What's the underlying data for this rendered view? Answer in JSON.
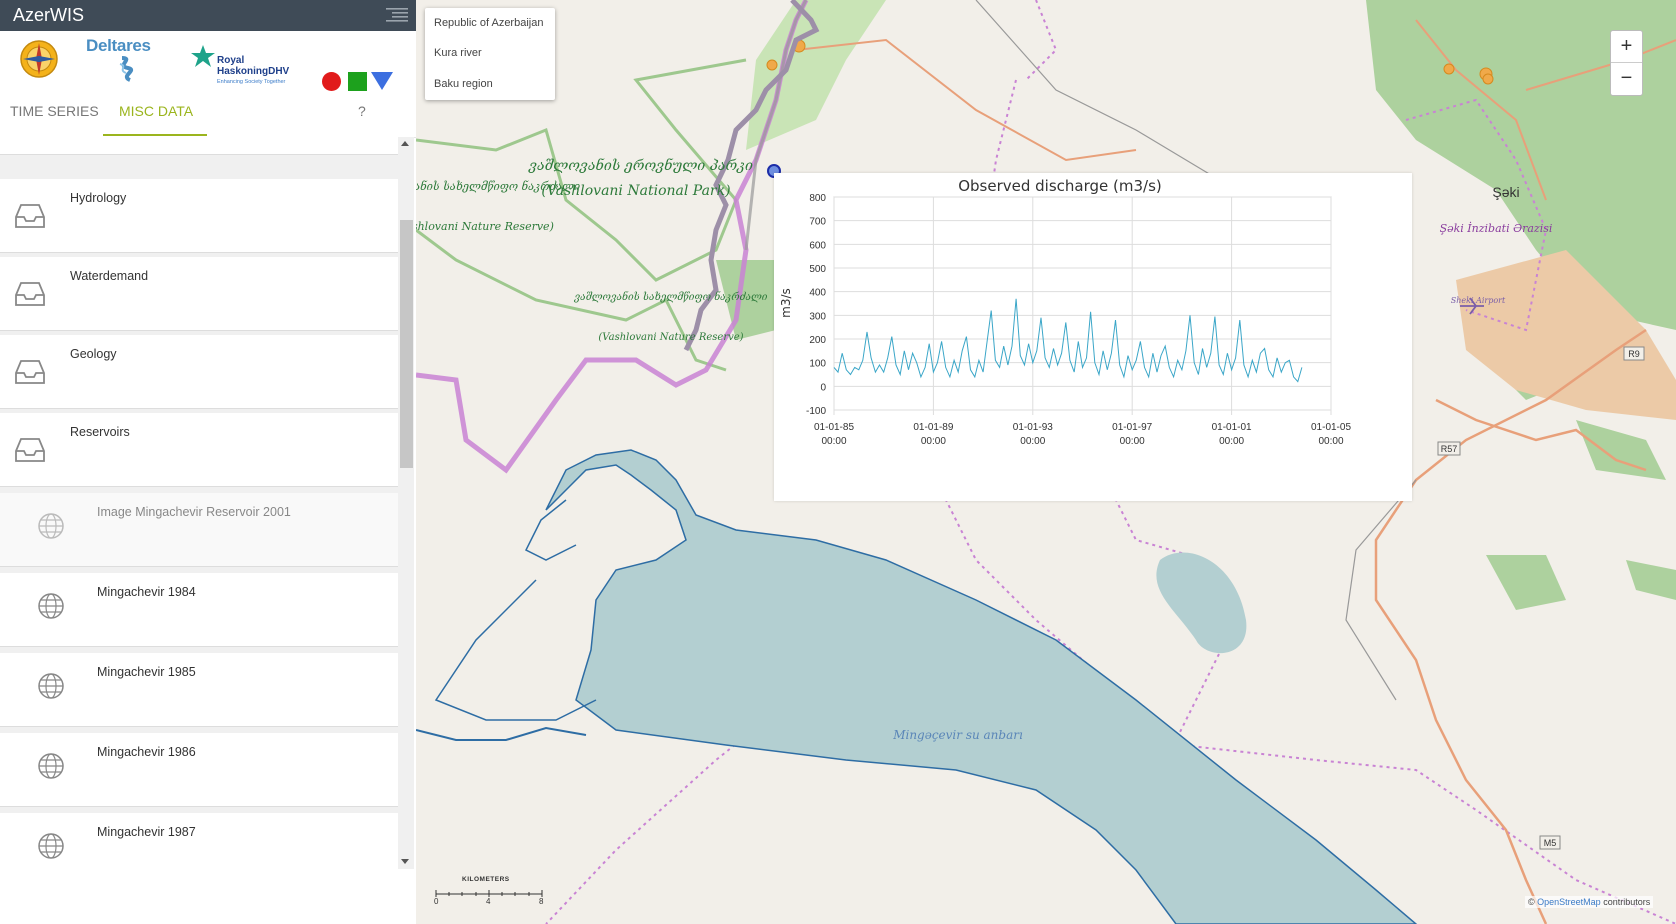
{
  "app": {
    "title": "AzerWIS"
  },
  "logos": {
    "deltares": "Deltares",
    "rhdhv_name": "Royal HaskoningDHV",
    "rhdhv_tagline": "Enhancing Society Together"
  },
  "tabs": {
    "time_series": "TIME SERIES",
    "misc_data": "MISC DATA",
    "help": "?"
  },
  "categories": [
    {
      "label": "Hydrology",
      "icon": "inbox-tray-icon"
    },
    {
      "label": "Waterdemand",
      "icon": "inbox-tray-icon"
    },
    {
      "label": "Geology",
      "icon": "inbox-tray-icon"
    },
    {
      "label": "Reservoirs",
      "icon": "inbox-tray-icon"
    }
  ],
  "layers": [
    {
      "label": "Image Mingachevir Reservoir 2001",
      "icon": "globe-icon",
      "enabled": false
    },
    {
      "label": "Mingachevir 1984",
      "icon": "globe-icon",
      "enabled": true
    },
    {
      "label": "Mingachevir 1985",
      "icon": "globe-icon",
      "enabled": true
    },
    {
      "label": "Mingachevir 1986",
      "icon": "globe-icon",
      "enabled": true
    },
    {
      "label": "Mingachevir 1987",
      "icon": "globe-icon",
      "enabled": true
    }
  ],
  "breadcrumb": [
    "Republic of Azerbaijan",
    "Kura river",
    "Baku region"
  ],
  "map": {
    "labels": {
      "vashlovani_np_ka": "ვაშლოვანის ეროვნული პარკი",
      "vashlovani_np_en": "(Vashlovani National Park)",
      "vashlovani_nr_ka": "ვაშლოვანის სახელმწიფო ნაკრძალი",
      "vashlovani_nr_en": "(Vashlovani Nature Reserve)",
      "reservoir": "Mingəçevir su anbarı",
      "city": "Şəki",
      "district": "Şəki İnzibati Ərazisi",
      "airport": "Sheki Airport",
      "road_r9": "R9",
      "road_r57": "R57",
      "road_m5": "M5"
    },
    "scalebar": {
      "title": "KILOMETERS",
      "ticks": [
        "0",
        "4",
        "8"
      ]
    },
    "attribution": {
      "prefix": "© ",
      "link": "OpenStreetMap",
      "suffix": " contributors"
    },
    "zoom": {
      "in": "+",
      "out": "−"
    },
    "colors": {
      "water": "#b3cfd1",
      "water_line": "#2e6da4",
      "forest": "#a9cf8c",
      "boundary": "#c77ad0",
      "highway": "#e8a07a",
      "farmland": "#e8c4a4"
    }
  },
  "chart_data": {
    "type": "line",
    "title": "Observed discharge (m3/s)",
    "ylabel": "m3/s",
    "xlabel": "",
    "ylim": [
      -100,
      800
    ],
    "yticks": [
      800,
      700,
      600,
      500,
      400,
      300,
      200,
      100,
      0,
      -100
    ],
    "xlim": [
      "1985-01-01",
      "2005-01-01"
    ],
    "xticks": [
      {
        "date": "1985-01-01",
        "label": "01-01-85",
        "time": "00:00"
      },
      {
        "date": "1989-01-01",
        "label": "01-01-89",
        "time": "00:00"
      },
      {
        "date": "1993-01-01",
        "label": "01-01-93",
        "time": "00:00"
      },
      {
        "date": "1997-01-01",
        "label": "01-01-97",
        "time": "00:00"
      },
      {
        "date": "2001-01-01",
        "label": "01-01-01",
        "time": "00:00"
      },
      {
        "date": "2005-01-01",
        "label": "01-01-05",
        "time": "00:00"
      }
    ],
    "grid": true,
    "series": [
      {
        "color": "#3aa6c8",
        "points": [
          [
            "1985-01-01",
            80
          ],
          [
            "1985-03-01",
            60
          ],
          [
            "1985-05-01",
            140
          ],
          [
            "1985-07-01",
            70
          ],
          [
            "1985-09-01",
            50
          ],
          [
            "1985-11-01",
            80
          ],
          [
            "1986-01-01",
            70
          ],
          [
            "1986-03-01",
            110
          ],
          [
            "1986-05-01",
            230
          ],
          [
            "1986-07-01",
            120
          ],
          [
            "1986-09-01",
            60
          ],
          [
            "1986-11-01",
            90
          ],
          [
            "1987-01-01",
            60
          ],
          [
            "1987-03-01",
            120
          ],
          [
            "1987-05-01",
            210
          ],
          [
            "1987-07-01",
            90
          ],
          [
            "1987-09-01",
            50
          ],
          [
            "1987-11-01",
            150
          ],
          [
            "1988-01-01",
            70
          ],
          [
            "1988-03-01",
            140
          ],
          [
            "1988-05-01",
            100
          ],
          [
            "1988-07-01",
            40
          ],
          [
            "1988-09-01",
            80
          ],
          [
            "1988-11-01",
            180
          ],
          [
            "1989-01-01",
            60
          ],
          [
            "1989-03-01",
            100
          ],
          [
            "1989-05-01",
            190
          ],
          [
            "1989-07-01",
            80
          ],
          [
            "1989-09-01",
            40
          ],
          [
            "1989-11-01",
            110
          ],
          [
            "1990-01-01",
            60
          ],
          [
            "1990-03-01",
            150
          ],
          [
            "1990-05-01",
            210
          ],
          [
            "1990-07-01",
            70
          ],
          [
            "1990-09-01",
            40
          ],
          [
            "1990-11-01",
            110
          ],
          [
            "1991-01-01",
            60
          ],
          [
            "1991-03-01",
            190
          ],
          [
            "1991-05-01",
            320
          ],
          [
            "1991-07-01",
            110
          ],
          [
            "1991-09-01",
            80
          ],
          [
            "1991-11-01",
            170
          ],
          [
            "1992-01-01",
            90
          ],
          [
            "1992-03-01",
            170
          ],
          [
            "1992-05-01",
            370
          ],
          [
            "1992-07-01",
            130
          ],
          [
            "1992-09-01",
            90
          ],
          [
            "1992-11-01",
            180
          ],
          [
            "1993-01-01",
            100
          ],
          [
            "1993-03-01",
            150
          ],
          [
            "1993-05-01",
            290
          ],
          [
            "1993-07-01",
            120
          ],
          [
            "1993-09-01",
            80
          ],
          [
            "1993-11-01",
            160
          ],
          [
            "1994-01-01",
            90
          ],
          [
            "1994-03-01",
            140
          ],
          [
            "1994-05-01",
            270
          ],
          [
            "1994-07-01",
            110
          ],
          [
            "1994-09-01",
            60
          ],
          [
            "1994-11-01",
            190
          ],
          [
            "1995-01-01",
            80
          ],
          [
            "1995-03-01",
            120
          ],
          [
            "1995-05-01",
            315
          ],
          [
            "1995-07-01",
            100
          ],
          [
            "1995-09-01",
            50
          ],
          [
            "1995-11-01",
            150
          ],
          [
            "1996-01-01",
            70
          ],
          [
            "1996-03-01",
            140
          ],
          [
            "1996-05-01",
            280
          ],
          [
            "1996-07-01",
            90
          ],
          [
            "1996-09-01",
            40
          ],
          [
            "1996-11-01",
            130
          ],
          [
            "1997-01-01",
            70
          ],
          [
            "1997-03-01",
            110
          ],
          [
            "1997-05-01",
            190
          ],
          [
            "1997-07-01",
            80
          ],
          [
            "1997-09-01",
            40
          ],
          [
            "1997-11-01",
            140
          ],
          [
            "1998-01-01",
            60
          ],
          [
            "1998-03-01",
            130
          ],
          [
            "1998-05-01",
            170
          ],
          [
            "1998-07-01",
            80
          ],
          [
            "1998-09-01",
            40
          ],
          [
            "1998-11-01",
            110
          ],
          [
            "1999-01-01",
            70
          ],
          [
            "1999-03-01",
            150
          ],
          [
            "1999-05-01",
            300
          ],
          [
            "1999-07-01",
            100
          ],
          [
            "1999-09-01",
            50
          ],
          [
            "1999-11-01",
            160
          ],
          [
            "2000-01-01",
            80
          ],
          [
            "2000-03-01",
            140
          ],
          [
            "2000-05-01",
            295
          ],
          [
            "2000-07-01",
            90
          ],
          [
            "2000-09-01",
            50
          ],
          [
            "2000-11-01",
            140
          ],
          [
            "2001-01-01",
            70
          ],
          [
            "2001-03-01",
            120
          ],
          [
            "2001-05-01",
            280
          ],
          [
            "2001-07-01",
            90
          ],
          [
            "2001-09-01",
            40
          ],
          [
            "2001-11-01",
            110
          ],
          [
            "2002-01-01",
            60
          ],
          [
            "2002-03-01",
            140
          ],
          [
            "2002-05-01",
            160
          ],
          [
            "2002-07-01",
            70
          ],
          [
            "2002-09-01",
            40
          ],
          [
            "2002-11-01",
            120
          ],
          [
            "2003-01-01",
            60
          ],
          [
            "2003-03-01",
            100
          ],
          [
            "2003-05-01",
            110
          ],
          [
            "2003-07-01",
            40
          ],
          [
            "2003-09-01",
            20
          ],
          [
            "2003-11-01",
            80
          ]
        ]
      }
    ]
  }
}
